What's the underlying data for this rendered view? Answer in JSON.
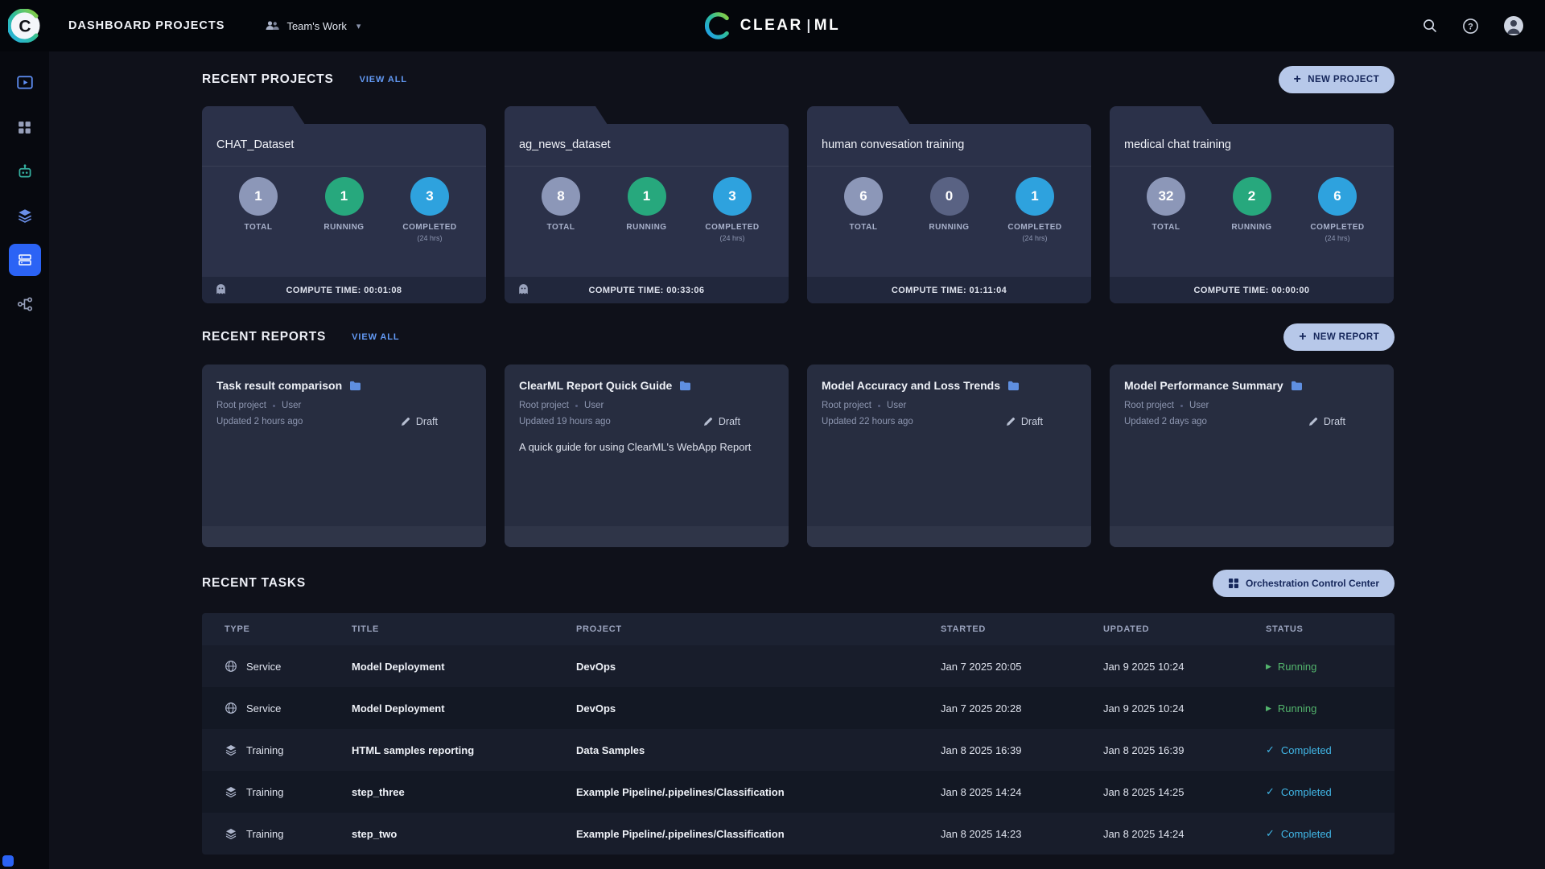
{
  "topbar": {
    "page_title": "DASHBOARD PROJECTS",
    "workspace_label": "Team's Work",
    "logo_left": "CLEAR",
    "logo_right": "ML"
  },
  "projects": {
    "section_title": "RECENT PROJECTS",
    "view_all": "VIEW ALL",
    "new_button": "NEW PROJECT",
    "labels": {
      "total": "TOTAL",
      "running": "RUNNING",
      "completed": "COMPLETED",
      "completed_sub": "(24 hrs)"
    },
    "cards": [
      {
        "title": "CHAT_Dataset",
        "total": {
          "value": "1",
          "color": "#8c97b8"
        },
        "running": {
          "value": "1",
          "color": "#27a87d"
        },
        "completed": {
          "value": "3",
          "color": "#2ea2de"
        },
        "compute_time": "COMPUTE TIME: 00:01:08"
      },
      {
        "title": "ag_news_dataset",
        "total": {
          "value": "8",
          "color": "#8c97b8"
        },
        "running": {
          "value": "1",
          "color": "#27a87d"
        },
        "completed": {
          "value": "3",
          "color": "#2ea2de"
        },
        "compute_time": "COMPUTE TIME: 00:33:06"
      },
      {
        "title": "human convesation training",
        "total": {
          "value": "6",
          "color": "#8c97b8"
        },
        "running": {
          "value": "0",
          "color": "#596283"
        },
        "completed": {
          "value": "1",
          "color": "#2ea2de"
        },
        "compute_time": "COMPUTE TIME: 01:11:04"
      },
      {
        "title": "medical chat training",
        "total": {
          "value": "32",
          "color": "#8c97b8"
        },
        "running": {
          "value": "2",
          "color": "#27a87d"
        },
        "completed": {
          "value": "6",
          "color": "#2ea2de"
        },
        "compute_time": "COMPUTE TIME: 00:00:00"
      }
    ]
  },
  "reports": {
    "section_title": "RECENT REPORTS",
    "view_all": "VIEW ALL",
    "new_button": "NEW REPORT",
    "cards": [
      {
        "title": "Task result comparison",
        "project": "Root project",
        "author": "User",
        "updated": "Updated 2 hours ago",
        "badge": "Draft",
        "description": ""
      },
      {
        "title": "ClearML Report Quick Guide",
        "project": "Root project",
        "author": "User",
        "updated": "Updated 19 hours ago",
        "badge": "Draft",
        "description": "A quick guide for using ClearML's WebApp Report"
      },
      {
        "title": "Model Accuracy and Loss Trends",
        "project": "Root project",
        "author": "User",
        "updated": "Updated 22 hours ago",
        "badge": "Draft",
        "description": ""
      },
      {
        "title": "Model Performance Summary",
        "project": "Root project",
        "author": "User",
        "updated": "Updated 2 days ago",
        "badge": "Draft",
        "description": ""
      }
    ]
  },
  "tasks": {
    "section_title": "RECENT TASKS",
    "orchestration_button": "Orchestration Control Center",
    "columns": [
      "TYPE",
      "TITLE",
      "PROJECT",
      "STARTED",
      "UPDATED",
      "STATUS"
    ],
    "rows": [
      {
        "type": "Service",
        "title": "Model Deployment",
        "project": "DevOps",
        "started": "Jan 7 2025 20:05",
        "updated": "Jan 9 2025 10:24",
        "status": "Running",
        "status_color": "#53b56d"
      },
      {
        "type": "Service",
        "title": "Model Deployment",
        "project": "DevOps",
        "started": "Jan 7 2025 20:28",
        "updated": "Jan 9 2025 10:24",
        "status": "Running",
        "status_color": "#53b56d"
      },
      {
        "type": "Training",
        "title": "HTML samples reporting",
        "project": "Data Samples",
        "started": "Jan 8 2025 16:39",
        "updated": "Jan 8 2025 16:39",
        "status": "Completed",
        "status_color": "#41b6e6"
      },
      {
        "type": "Training",
        "title": "step_three",
        "project": "Example Pipeline/.pipelines/Classification",
        "started": "Jan 8 2025 14:24",
        "updated": "Jan 8 2025 14:25",
        "status": "Completed",
        "status_color": "#41b6e6"
      },
      {
        "type": "Training",
        "title": "step_two",
        "project": "Example Pipeline/.pipelines/Classification",
        "started": "Jan 8 2025 14:23",
        "updated": "Jan 8 2025 14:24",
        "status": "Completed",
        "status_color": "#41b6e6"
      }
    ]
  }
}
